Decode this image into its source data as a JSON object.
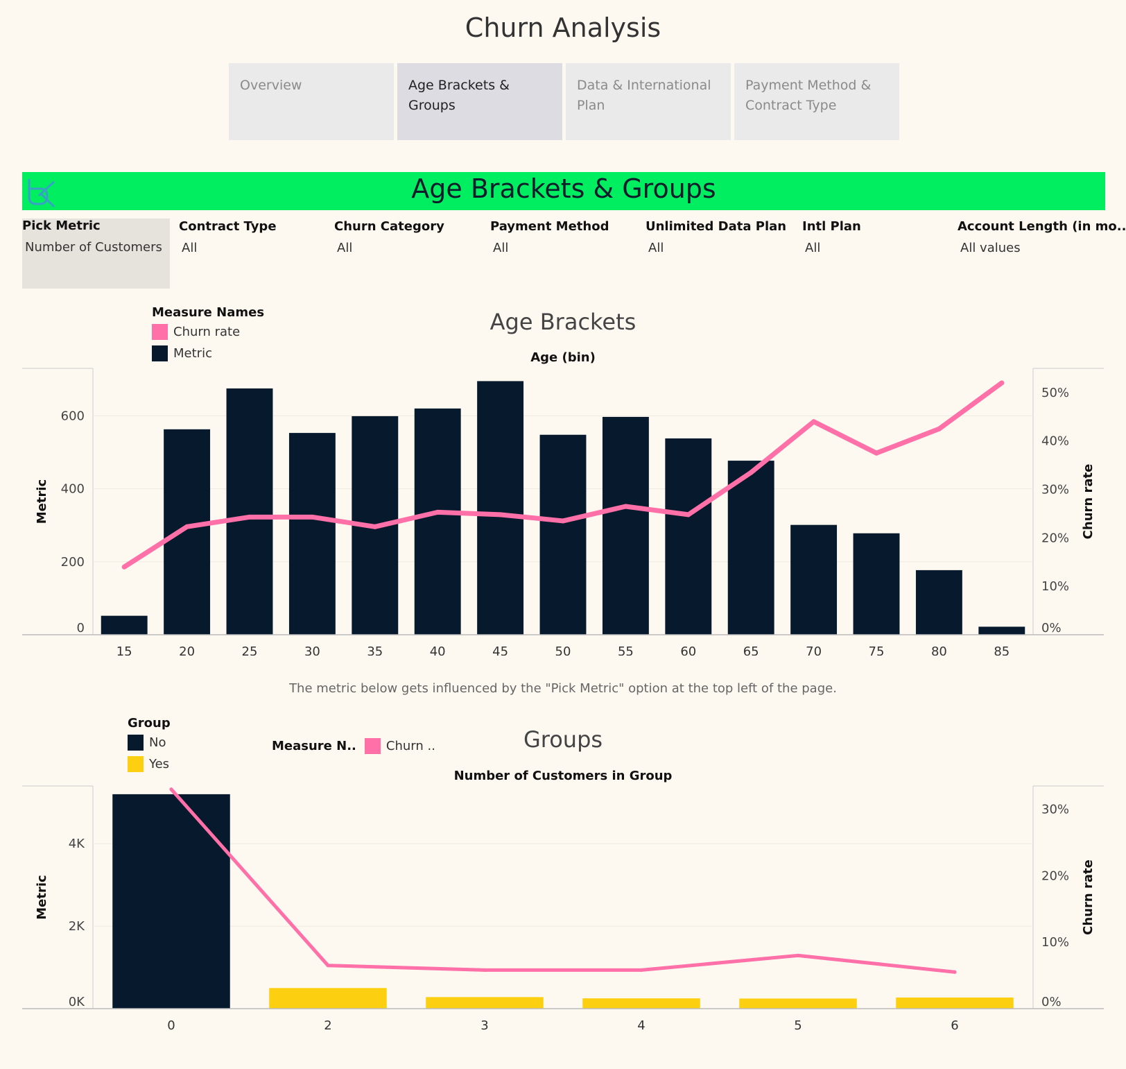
{
  "page": {
    "title": "Churn Analysis"
  },
  "tabs": [
    {
      "label": "Overview",
      "active": false
    },
    {
      "label": "Age Brackets & Groups",
      "active": true
    },
    {
      "label": "Data & International Plan",
      "active": false
    },
    {
      "label": "Payment Method & Contract Type",
      "active": false
    }
  ],
  "banner": {
    "title": "Age Brackets & Groups",
    "color": "#00ee60",
    "logo_icon": "dk-logo-icon"
  },
  "filters": {
    "pick_metric": {
      "label": "Pick Metric",
      "value": "Number of Customers"
    },
    "contract_type": {
      "label": "Contract Type",
      "value": "All"
    },
    "churn_category": {
      "label": "Churn Category",
      "value": "All"
    },
    "payment_method": {
      "label": "Payment Method",
      "value": "All"
    },
    "unlimited_data_plan": {
      "label": "Unlimited Data Plan",
      "value": "All"
    },
    "intl_plan": {
      "label": "Intl Plan",
      "value": "All"
    },
    "account_length": {
      "label": "Account Length (in mo..",
      "value": "All values"
    }
  },
  "age_legend": {
    "title": "Measure Names",
    "items": [
      {
        "label": "Churn rate",
        "color": "#ff6fa8"
      },
      {
        "label": "Metric",
        "color": "#07192c"
      }
    ]
  },
  "note": "The metric below gets influenced by the \"Pick Metric\" option at the top left of the page.",
  "groups_legend": {
    "title": "Group",
    "items": [
      {
        "label": "No",
        "color": "#07192c"
      },
      {
        "label": "Yes",
        "color": "#fcd011"
      }
    ],
    "measure_title": "Measure N..",
    "measure_item": {
      "label": "Churn ..",
      "color": "#ff6fa8"
    }
  },
  "chart_data": [
    {
      "type": "bar",
      "title": "Age Brackets",
      "xlabel": "Age (bin)",
      "ylabel": "Metric",
      "y2label": "Churn rate",
      "categories": [
        "15",
        "20",
        "25",
        "30",
        "35",
        "40",
        "45",
        "50",
        "55",
        "60",
        "65",
        "70",
        "75",
        "80",
        "85"
      ],
      "series": [
        {
          "name": "Metric",
          "type": "bar",
          "color": "#07192c",
          "values": [
            52,
            563,
            675,
            553,
            599,
            620,
            695,
            548,
            597,
            538,
            477,
            301,
            278,
            177,
            22
          ]
        },
        {
          "name": "Churn rate",
          "type": "line",
          "axis": "right",
          "color": "#ff6fa8",
          "values": [
            0.14,
            0.223,
            0.243,
            0.243,
            0.223,
            0.253,
            0.248,
            0.235,
            0.265,
            0.248,
            0.335,
            0.44,
            0.375,
            0.425,
            0.52
          ]
        }
      ],
      "ylim": [
        0,
        730
      ],
      "y2lim": [
        0,
        0.55
      ],
      "yticks": [
        {
          "v": 0,
          "label": "0"
        },
        {
          "v": 200,
          "label": "200"
        },
        {
          "v": 400,
          "label": "400"
        },
        {
          "v": 600,
          "label": "600"
        }
      ],
      "y2ticks": [
        {
          "v": 0,
          "label": "0%"
        },
        {
          "v": 0.1,
          "label": "10%"
        },
        {
          "v": 0.2,
          "label": "20%"
        },
        {
          "v": 0.3,
          "label": "30%"
        },
        {
          "v": 0.4,
          "label": "40%"
        },
        {
          "v": 0.5,
          "label": "50%"
        }
      ],
      "grid": true
    },
    {
      "type": "bar",
      "title": "Groups",
      "xlabel": "Number of Customers in Group",
      "ylabel": "Metric",
      "y2label": "Churn rate",
      "categories": [
        "0",
        "2",
        "3",
        "4",
        "5",
        "6"
      ],
      "series": [
        {
          "name": "Metric",
          "type": "bar",
          "values": [
            5200,
            500,
            280,
            250,
            245,
            270
          ],
          "groups": [
            "No",
            "Yes",
            "Yes",
            "Yes",
            "Yes",
            "Yes"
          ]
        },
        {
          "name": "Churn rate",
          "type": "line",
          "axis": "right",
          "color": "#ff6fa8",
          "values": [
            0.33,
            0.065,
            0.058,
            0.058,
            0.08,
            0.055
          ]
        }
      ],
      "ylim": [
        0,
        5400
      ],
      "y2lim": [
        0,
        0.335
      ],
      "yticks": [
        {
          "v": 0,
          "label": "0K"
        },
        {
          "v": 2000,
          "label": "2K"
        },
        {
          "v": 4000,
          "label": "4K"
        }
      ],
      "y2ticks": [
        {
          "v": 0,
          "label": "0%"
        },
        {
          "v": 0.1,
          "label": "10%"
        },
        {
          "v": 0.2,
          "label": "20%"
        },
        {
          "v": 0.3,
          "label": "30%"
        }
      ],
      "group_colors": {
        "No": "#07192c",
        "Yes": "#fcd011"
      },
      "grid": true
    }
  ]
}
